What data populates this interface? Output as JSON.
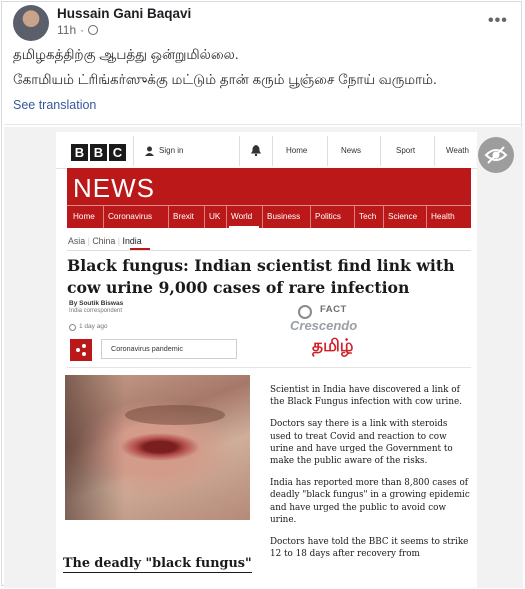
{
  "post": {
    "author": "Hussain Gani Baqavi",
    "time": "11h",
    "more_icon": "•••",
    "text_line1": "தமிழகத்திற்கு ஆபத்து ஒன்றுமில்லை.",
    "text_line2": "கோமியம் ட்ரிங்கர்ஸுக்கு மட்டும் தான் கரும் பூஞ்சை நோய் வருமாம்.",
    "see_translation": "See translation"
  },
  "bbc": {
    "logo": [
      "B",
      "B",
      "C"
    ],
    "sign_in": "Sign in",
    "top_nav": [
      "Home",
      "News",
      "Sport",
      "Weath"
    ],
    "news_title": "NEWS",
    "nav": [
      "Home",
      "Coronavirus",
      "Brexit",
      "UK",
      "World",
      "Business",
      "Politics",
      "Tech",
      "Science",
      "Health"
    ],
    "active_nav": "World",
    "subnav": {
      "asia": "Asia",
      "china": "China",
      "india": "India",
      "sep": "|"
    },
    "headline": "Black fungus: Indian scientist find link with cow urine 9,000 cases of rare infection",
    "byline": "By Soutik Biswas",
    "byline_title": "India correspondent",
    "time_ago": "1 day ago",
    "topic_tag": "Coronavirus pandemic",
    "paragraphs": [
      "Scientist in India have discovered a link of the Black Fungus infection with cow urine.",
      "Doctors say there is a link with steroids used to treat Covid and reaction to cow urine and have urged the Government to make the public aware of the risks.",
      "India has reported more than 8,800 cases of deadly \"black fungus\" in a growing epidemic and have urged the public to avoid cow urine.",
      "Doctors have told the BBC it seems to strike 12 to 18 days after recovery from"
    ],
    "subheading": "The deadly \"black fungus\""
  },
  "watermark": {
    "fact": "FACT",
    "crescendo": "Crescendo",
    "tamil": "தமிழ்"
  },
  "colors": {
    "bbc_red": "#bb1919",
    "link_blue": "#385898",
    "fb_gray": "#65676b"
  }
}
